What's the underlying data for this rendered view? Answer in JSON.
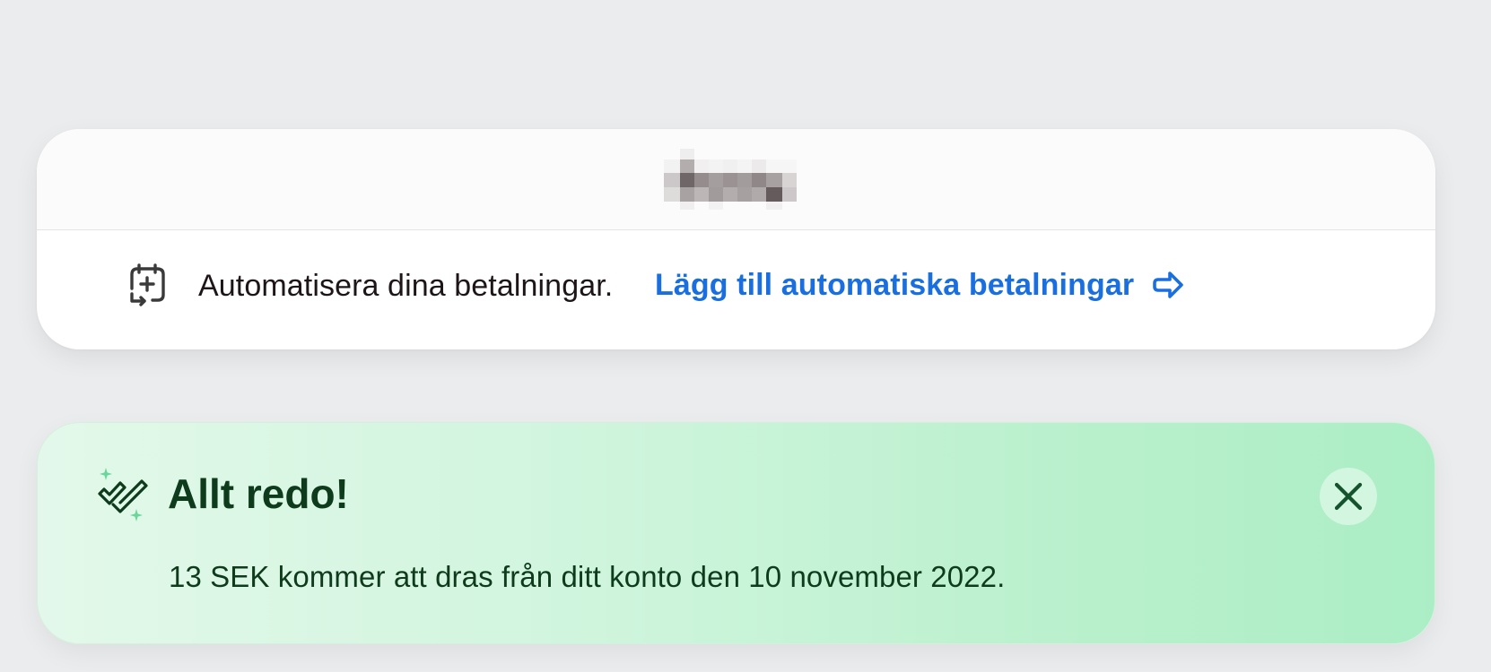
{
  "header": {
    "blurred_title": ""
  },
  "automate": {
    "text": "Automatisera dina betalningar.",
    "link_label": "Lägg till automatiska betalningar",
    "link_color": "#1a6fe0",
    "icon": "calendar-plus-icon",
    "link_icon": "arrow-right-icon"
  },
  "success": {
    "title": "Allt redo!",
    "message": "13 SEK kommer att dras från ditt konto den 10 november 2022.",
    "icon": "sparkle-double-check-icon",
    "close_icon": "close-icon",
    "accent_color": "#0d3b1c",
    "background_color": "#c5f3d6"
  }
}
